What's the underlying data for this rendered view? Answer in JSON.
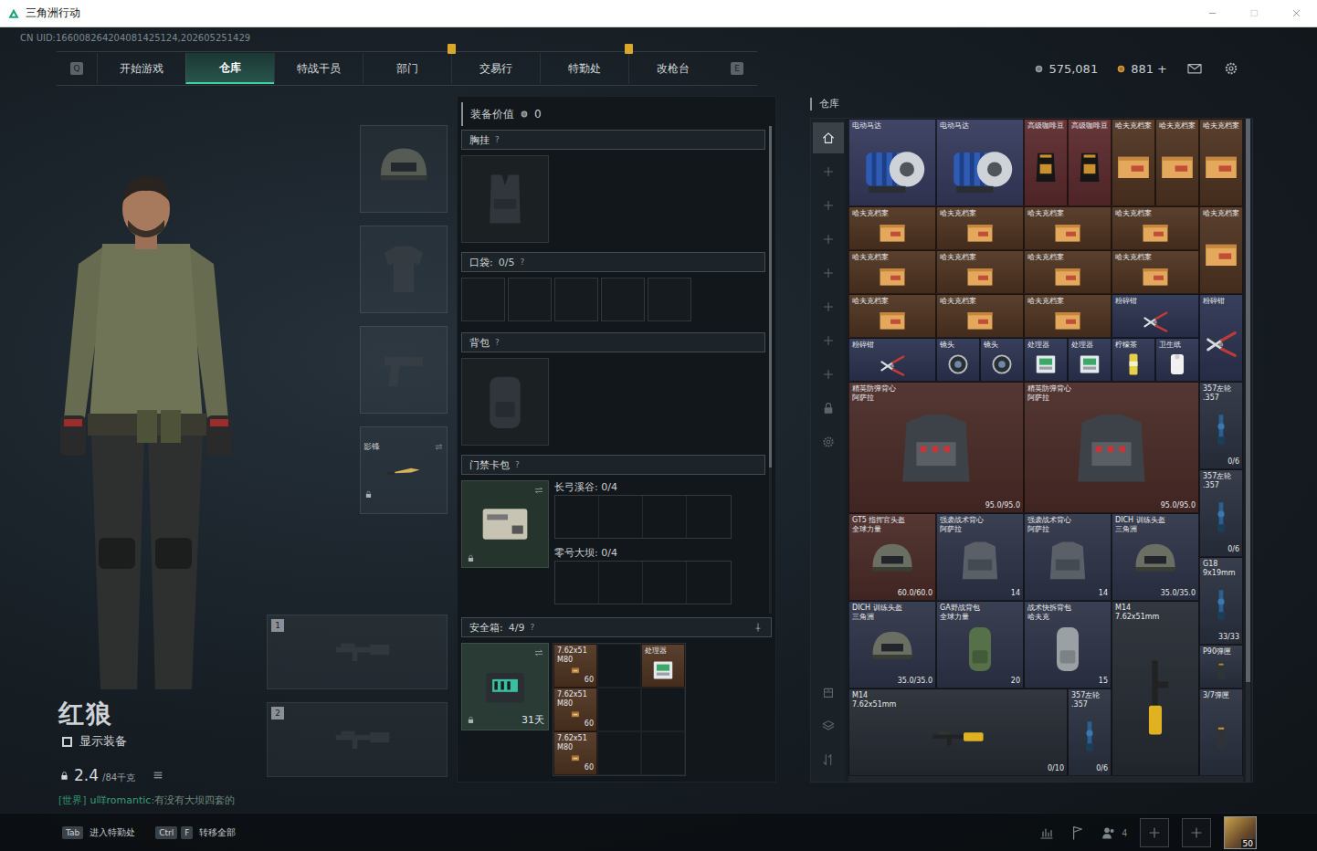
{
  "window": {
    "title": "三角洲行动"
  },
  "uid": "CN UID:166008264204081425124,202605251429",
  "nav": {
    "left_key": "Q",
    "right_key": "E",
    "tabs": [
      {
        "label": "开始游戏",
        "selected": false,
        "alert": false
      },
      {
        "label": "仓库",
        "selected": true,
        "alert": false
      },
      {
        "label": "特战干员",
        "selected": false,
        "alert": false
      },
      {
        "label": "部门",
        "selected": false,
        "alert": true
      },
      {
        "label": "交易行",
        "selected": false,
        "alert": false
      },
      {
        "label": "特勤处",
        "selected": false,
        "alert": true
      },
      {
        "label": "改枪台",
        "selected": false,
        "alert": false
      }
    ]
  },
  "currency": [
    {
      "kind": "coin",
      "amount": "575,081"
    },
    {
      "kind": "gold",
      "amount": "881 +"
    }
  ],
  "character": {
    "name": "红狼",
    "show_equipment": {
      "label": "显示装备",
      "checked": false
    },
    "weight": "2.4",
    "capacity": "/84千克"
  },
  "chat": {
    "channel": "[世界]",
    "user": "u咩romantic",
    "message": ":有没有大坝四套的"
  },
  "equipment": [
    {
      "kind": "helmet",
      "locked": false
    },
    {
      "kind": "shirt",
      "locked": false
    },
    {
      "kind": "handgun",
      "locked": false
    },
    {
      "kind": "knife",
      "label": "影锋",
      "locked": true
    }
  ],
  "weapon_slots": [
    "1",
    "2"
  ],
  "loadout": {
    "value_label": "装备价值",
    "value": "0",
    "help": "?",
    "chest": "胸挂",
    "pocket": {
      "label": "口袋:",
      "count": "0/5",
      "slots": 5
    },
    "backpack": "背包",
    "keycard": {
      "label": "门禁卡包",
      "locked": true,
      "maps": [
        {
          "label": "长弓溪谷:",
          "count": "0/4",
          "slots": 4
        },
        {
          "label": "零号大坝:",
          "count": "0/4",
          "slots": 4
        }
      ]
    },
    "safe": {
      "label": "安全箱:",
      "count": "4/9",
      "timer": "31天",
      "locked": true,
      "items": [
        {
          "name": "7.62x51",
          "sub": "M80",
          "value": "60",
          "kind": "ammo",
          "color": "#4f3421"
        },
        {
          "name": "7.62x51",
          "sub": "M80",
          "value": "60",
          "kind": "ammo",
          "color": "#4f3421"
        },
        {
          "name": "7.62x51",
          "sub": "M80",
          "value": "60",
          "kind": "ammo",
          "color": "#4f3421"
        },
        {
          "name": "处理器",
          "kind": "cpu",
          "color": "#4f3421"
        }
      ]
    }
  },
  "warehouse": {
    "title": "仓库",
    "tabs": [
      {
        "kind": "home",
        "selected": true
      },
      {
        "kind": "add",
        "selected": false
      },
      {
        "kind": "add",
        "selected": false
      },
      {
        "kind": "add",
        "selected": false
      },
      {
        "kind": "add",
        "selected": false
      },
      {
        "kind": "add",
        "selected": false
      },
      {
        "kind": "add",
        "selected": false
      },
      {
        "kind": "add",
        "selected": false
      },
      {
        "kind": "lock",
        "selected": false
      },
      {
        "kind": "settings",
        "selected": false
      }
    ],
    "tools": [
      {
        "kind": "depot"
      },
      {
        "kind": "layers"
      },
      {
        "kind": "sort"
      }
    ],
    "items": [
      {
        "name": "电动马达",
        "kind": "motor",
        "color": "#363a5c"
      },
      {
        "name": "电动马达",
        "kind": "motor",
        "color": "#363a5c"
      },
      {
        "name": "高级咖啡豆",
        "kind": "coffee",
        "color": "#5c2a2e"
      },
      {
        "name": "高级咖啡豆",
        "kind": "coffee",
        "color": "#5c2a2e"
      },
      {
        "name": "哈夫克档案",
        "kind": "archive",
        "color": "#4f3421"
      },
      {
        "name": "哈夫克档案",
        "kind": "archive",
        "color": "#4f3421"
      },
      {
        "name": "哈夫克档案",
        "kind": "archive",
        "color": "#4f3421"
      },
      {
        "name": "哈夫克档案",
        "kind": "archive",
        "color": "#4f3421"
      },
      {
        "name": "哈夫克档案",
        "kind": "archive",
        "color": "#4f3421"
      },
      {
        "name": "哈夫克档案",
        "kind": "archive",
        "color": "#4f3421"
      },
      {
        "name": "哈夫克档案",
        "kind": "archive",
        "color": "#4f3421"
      },
      {
        "name": "哈夫克档案",
        "kind": "archive",
        "color": "#4f3421"
      },
      {
        "name": "哈夫克档案",
        "kind": "archive",
        "color": "#4f3421"
      },
      {
        "name": "哈夫克档案",
        "kind": "archive",
        "color": "#4f3421"
      },
      {
        "name": "哈夫克档案",
        "kind": "archive",
        "color": "#4f3421"
      },
      {
        "name": "哈夫克档案",
        "kind": "archive",
        "color": "#4f3421"
      },
      {
        "name": "哈夫克档案",
        "kind": "archive",
        "color": "#4f3421"
      },
      {
        "name": "哈夫克档案",
        "kind": "archive",
        "color": "#4f3421"
      },
      {
        "name": "哈夫克档案",
        "kind": "archive",
        "color": "#4f3421"
      },
      {
        "name": "粉碎钳",
        "kind": "pliers",
        "color": "#2c3350"
      },
      {
        "name": "粉碎钳",
        "kind": "pliers",
        "color": "#2c3350"
      },
      {
        "name": "粉碎钳",
        "kind": "pliers",
        "color": "#2c3350"
      },
      {
        "name": "镜头",
        "kind": "lens",
        "color": "#2c3350"
      },
      {
        "name": "镜头",
        "kind": "lens",
        "color": "#2c3350"
      },
      {
        "name": "处理器",
        "kind": "cpu",
        "color": "#2c3350"
      },
      {
        "name": "处理器",
        "kind": "cpu",
        "color": "#2c3350"
      },
      {
        "name": "柠檬茶",
        "kind": "drink",
        "color": "#2c3350"
      },
      {
        "name": "卫生纸",
        "kind": "roll",
        "color": "#2c3350"
      },
      {
        "name": "精英防弹背心",
        "sub": "阿萨拉",
        "value": "95.0/95.0",
        "kind": "armor",
        "color": "#4a2b27"
      },
      {
        "name": "精英防弹背心",
        "sub": "阿萨拉",
        "value": "95.0/95.0",
        "kind": "armor",
        "color": "#4a2b27"
      },
      {
        "name": "357左轮",
        "sub": ".357",
        "value": "0/6",
        "kind": "pistol",
        "color": "#2b3140"
      },
      {
        "name": "357左轮",
        "sub": ".357",
        "value": "0/6",
        "kind": "pistol",
        "color": "#2b3140"
      },
      {
        "name": "GT5 指挥官头盔",
        "sub": "全球力量",
        "value": "60.0/60.0",
        "kind": "helmet",
        "color": "#4a2b27"
      },
      {
        "name": "强袭战术背心",
        "sub": "阿萨拉",
        "value": "14",
        "kind": "vest",
        "color": "#2e3448"
      },
      {
        "name": "强袭战术背心",
        "sub": "阿萨拉",
        "value": "14",
        "kind": "vest",
        "color": "#2e3448"
      },
      {
        "name": "DICH 训练头盔",
        "sub": "三角洲",
        "value": "35.0/35.0",
        "kind": "helmet",
        "color": "#2e3448"
      },
      {
        "name": "G18",
        "sub": "9x19mm",
        "value": "33/33",
        "kind": "pistol",
        "color": "#2b3140"
      },
      {
        "name": "DICH 训练头盔",
        "sub": "三角洲",
        "value": "35.0/35.0",
        "kind": "helmet",
        "color": "#2e3448"
      },
      {
        "name": "GA野战背包",
        "sub": "全球力量",
        "value": "20",
        "kind": "backpack",
        "color": "#2e3448"
      },
      {
        "name": "战术快拆背包",
        "sub": "哈夫克",
        "value": "15",
        "kind": "pack",
        "color": "#2e3448"
      },
      {
        "name": "M14",
        "sub": "7.62x51mm",
        "kind": "rifle-vertical",
        "color": "#262b33"
      },
      {
        "name": "P90弹匣",
        "kind": "mag",
        "color": "#2b3140"
      },
      {
        "name": "M14",
        "sub": "7.62x51mm",
        "value": "0/10",
        "kind": "rifle",
        "color": "#262b33"
      },
      {
        "name": "357左轮",
        "sub": ".357",
        "value": "0/6",
        "kind": "pistol",
        "color": "#2b3140"
      },
      {
        "name": "3/7弹匣",
        "kind": "mag",
        "color": "#2b3140"
      }
    ]
  },
  "hints": [
    {
      "keys": [
        "Tab"
      ],
      "label": "进入特勤处"
    },
    {
      "keys": [
        "Ctrl",
        "F"
      ],
      "label": "转移全部"
    }
  ],
  "social": {
    "friends": "4",
    "level": "50"
  }
}
